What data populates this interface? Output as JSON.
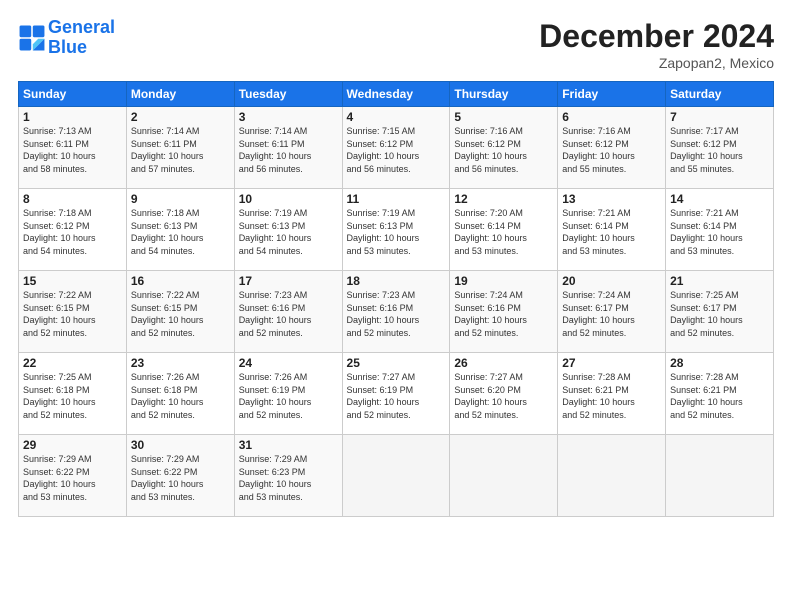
{
  "logo": {
    "line1": "General",
    "line2": "Blue"
  },
  "title": "December 2024",
  "location": "Zapopan2, Mexico",
  "header_days": [
    "Sunday",
    "Monday",
    "Tuesday",
    "Wednesday",
    "Thursday",
    "Friday",
    "Saturday"
  ],
  "weeks": [
    [
      {
        "day": "1",
        "info": "Sunrise: 7:13 AM\nSunset: 6:11 PM\nDaylight: 10 hours\nand 58 minutes."
      },
      {
        "day": "2",
        "info": "Sunrise: 7:14 AM\nSunset: 6:11 PM\nDaylight: 10 hours\nand 57 minutes."
      },
      {
        "day": "3",
        "info": "Sunrise: 7:14 AM\nSunset: 6:11 PM\nDaylight: 10 hours\nand 56 minutes."
      },
      {
        "day": "4",
        "info": "Sunrise: 7:15 AM\nSunset: 6:12 PM\nDaylight: 10 hours\nand 56 minutes."
      },
      {
        "day": "5",
        "info": "Sunrise: 7:16 AM\nSunset: 6:12 PM\nDaylight: 10 hours\nand 56 minutes."
      },
      {
        "day": "6",
        "info": "Sunrise: 7:16 AM\nSunset: 6:12 PM\nDaylight: 10 hours\nand 55 minutes."
      },
      {
        "day": "7",
        "info": "Sunrise: 7:17 AM\nSunset: 6:12 PM\nDaylight: 10 hours\nand 55 minutes."
      }
    ],
    [
      {
        "day": "8",
        "info": "Sunrise: 7:18 AM\nSunset: 6:12 PM\nDaylight: 10 hours\nand 54 minutes."
      },
      {
        "day": "9",
        "info": "Sunrise: 7:18 AM\nSunset: 6:13 PM\nDaylight: 10 hours\nand 54 minutes."
      },
      {
        "day": "10",
        "info": "Sunrise: 7:19 AM\nSunset: 6:13 PM\nDaylight: 10 hours\nand 54 minutes."
      },
      {
        "day": "11",
        "info": "Sunrise: 7:19 AM\nSunset: 6:13 PM\nDaylight: 10 hours\nand 53 minutes."
      },
      {
        "day": "12",
        "info": "Sunrise: 7:20 AM\nSunset: 6:14 PM\nDaylight: 10 hours\nand 53 minutes."
      },
      {
        "day": "13",
        "info": "Sunrise: 7:21 AM\nSunset: 6:14 PM\nDaylight: 10 hours\nand 53 minutes."
      },
      {
        "day": "14",
        "info": "Sunrise: 7:21 AM\nSunset: 6:14 PM\nDaylight: 10 hours\nand 53 minutes."
      }
    ],
    [
      {
        "day": "15",
        "info": "Sunrise: 7:22 AM\nSunset: 6:15 PM\nDaylight: 10 hours\nand 52 minutes."
      },
      {
        "day": "16",
        "info": "Sunrise: 7:22 AM\nSunset: 6:15 PM\nDaylight: 10 hours\nand 52 minutes."
      },
      {
        "day": "17",
        "info": "Sunrise: 7:23 AM\nSunset: 6:16 PM\nDaylight: 10 hours\nand 52 minutes."
      },
      {
        "day": "18",
        "info": "Sunrise: 7:23 AM\nSunset: 6:16 PM\nDaylight: 10 hours\nand 52 minutes."
      },
      {
        "day": "19",
        "info": "Sunrise: 7:24 AM\nSunset: 6:16 PM\nDaylight: 10 hours\nand 52 minutes."
      },
      {
        "day": "20",
        "info": "Sunrise: 7:24 AM\nSunset: 6:17 PM\nDaylight: 10 hours\nand 52 minutes."
      },
      {
        "day": "21",
        "info": "Sunrise: 7:25 AM\nSunset: 6:17 PM\nDaylight: 10 hours\nand 52 minutes."
      }
    ],
    [
      {
        "day": "22",
        "info": "Sunrise: 7:25 AM\nSunset: 6:18 PM\nDaylight: 10 hours\nand 52 minutes."
      },
      {
        "day": "23",
        "info": "Sunrise: 7:26 AM\nSunset: 6:18 PM\nDaylight: 10 hours\nand 52 minutes."
      },
      {
        "day": "24",
        "info": "Sunrise: 7:26 AM\nSunset: 6:19 PM\nDaylight: 10 hours\nand 52 minutes."
      },
      {
        "day": "25",
        "info": "Sunrise: 7:27 AM\nSunset: 6:19 PM\nDaylight: 10 hours\nand 52 minutes."
      },
      {
        "day": "26",
        "info": "Sunrise: 7:27 AM\nSunset: 6:20 PM\nDaylight: 10 hours\nand 52 minutes."
      },
      {
        "day": "27",
        "info": "Sunrise: 7:28 AM\nSunset: 6:21 PM\nDaylight: 10 hours\nand 52 minutes."
      },
      {
        "day": "28",
        "info": "Sunrise: 7:28 AM\nSunset: 6:21 PM\nDaylight: 10 hours\nand 52 minutes."
      }
    ],
    [
      {
        "day": "29",
        "info": "Sunrise: 7:29 AM\nSunset: 6:22 PM\nDaylight: 10 hours\nand 53 minutes."
      },
      {
        "day": "30",
        "info": "Sunrise: 7:29 AM\nSunset: 6:22 PM\nDaylight: 10 hours\nand 53 minutes."
      },
      {
        "day": "31",
        "info": "Sunrise: 7:29 AM\nSunset: 6:23 PM\nDaylight: 10 hours\nand 53 minutes."
      },
      null,
      null,
      null,
      null
    ]
  ]
}
